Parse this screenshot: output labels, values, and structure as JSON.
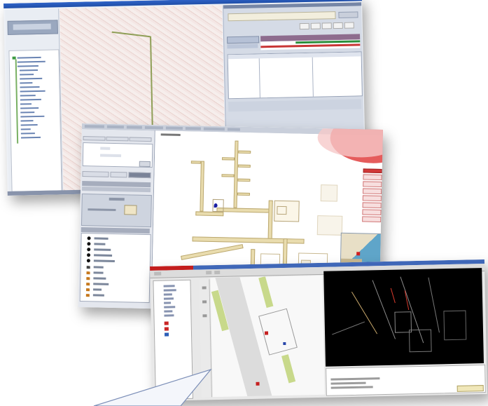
{
  "screens": [
    {
      "id": "back",
      "window": "map-application"
    },
    {
      "id": "middle",
      "window": "floorplan-application"
    },
    {
      "id": "front",
      "window": "cad-application"
    }
  ],
  "colors": {
    "titlebar": "#2457bd",
    "map_background": "#f6ecea",
    "alarm_red": "#c31d1d",
    "cad_background": "#000000",
    "road_yellow": "#e9dcae",
    "grass_green": "#c8d98b",
    "callout": "#7c8fb8"
  },
  "icons": [
    "floorplan-marker-icon",
    "tree-folder-icon",
    "legend-symbol-icon",
    "minimap-marker-icon"
  ]
}
